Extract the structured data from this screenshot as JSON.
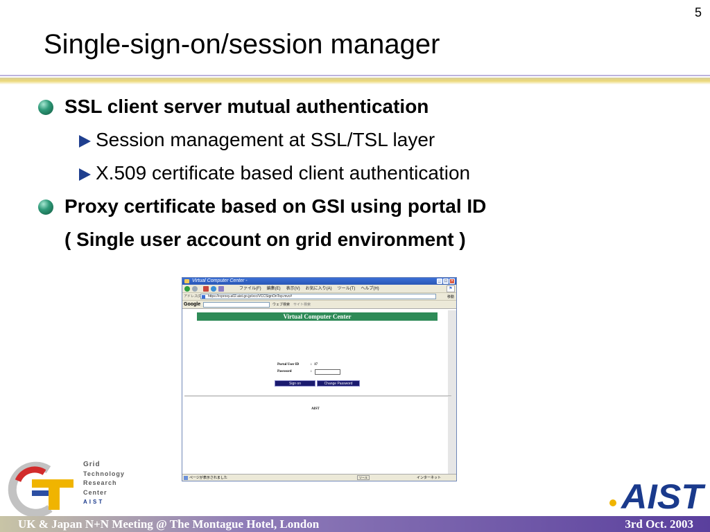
{
  "slide": {
    "page_number": "5",
    "title": "Single-sign-on/session manager",
    "bullets": [
      {
        "text": "SSL client server mutual authentication"
      },
      {
        "text": "Session management at SSL/TSL layer"
      },
      {
        "text": "X.509 certificate based client authentication"
      },
      {
        "text": "Proxy certificate based on GSI using portal ID"
      },
      {
        "text": "( Single user account on grid environment )"
      }
    ],
    "footer_left": "UK & Japan N+N Meeting   @  The Montague Hotel, London",
    "footer_right": "3rd Oct. 2003"
  },
  "browser": {
    "window_title": "Virtual Computer Center -",
    "menus": [
      "ファイル(F)",
      "編集(E)",
      "表示(V)",
      "お気に入り(A)",
      "ツール(T)",
      "ヘルプ(H)"
    ],
    "address_label": "アドレス(D)",
    "url": "https://rcproxy.a02.aist.go.jp/vcc/VCCSignOnTop.mvc#",
    "go_label": "移動",
    "google_label": "Google",
    "google_search_label": "ウェブ検索",
    "google_site_label": "サイト検索",
    "page": {
      "banner": "Virtual Computer Center",
      "portal_user_label": "Portal User ID",
      "portal_user_sep": ":",
      "portal_user_value": "17",
      "password_label": "Password",
      "password_sep": ":",
      "signon_button": "Sign on",
      "change_password_button": "Change Password",
      "footer_text": "AIST"
    },
    "status_text": "ページが表示されました",
    "status_zone": "インターネット",
    "status_box": "ツール"
  },
  "logos": {
    "gtrc_lines": [
      "Grid",
      "Technology",
      "Research",
      "Center",
      "AIST"
    ],
    "aist_text": "AIST"
  },
  "colors": {
    "banner_green": "#2e8b57",
    "button_navy": "#1a1a6e",
    "bullet_arrow": "#1f3f8f",
    "aist_blue": "#1a3a8c"
  }
}
